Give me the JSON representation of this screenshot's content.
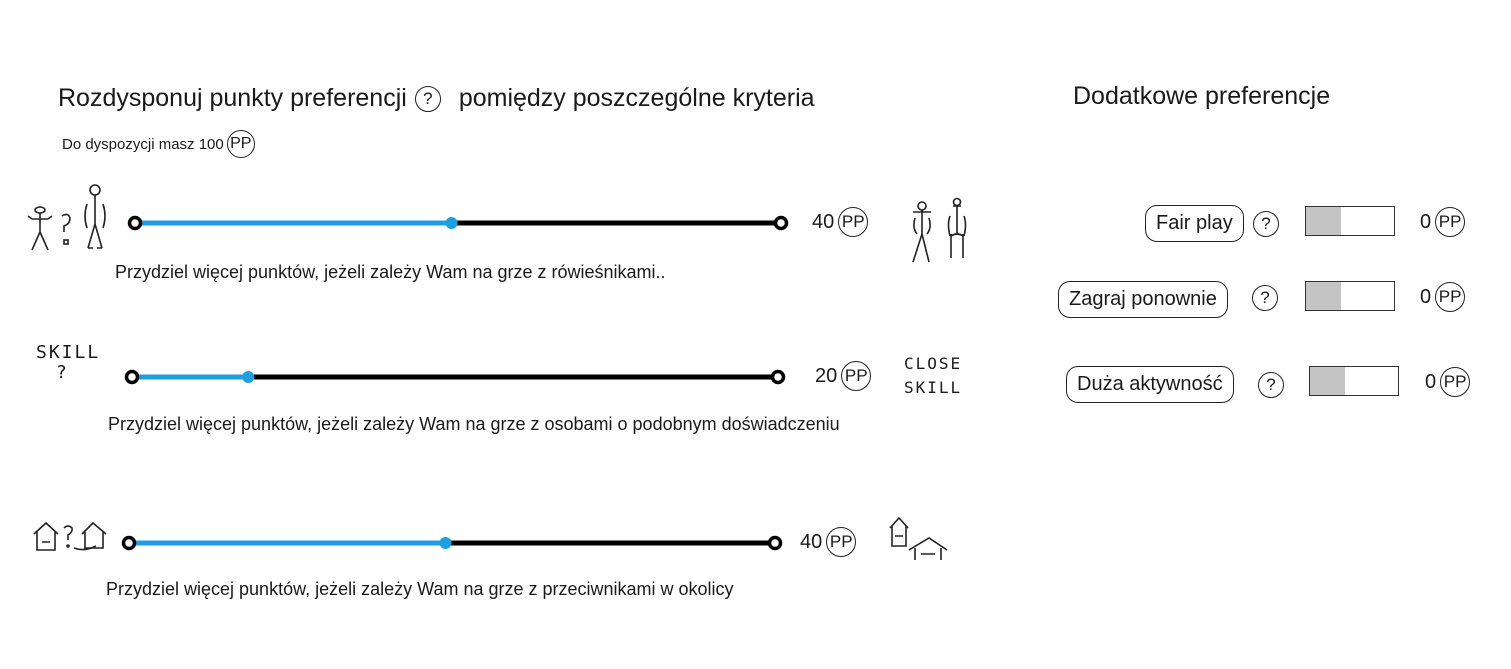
{
  "header": {
    "title_part1": "Rozdysponuj punkty preferencji",
    "title_help": "?",
    "title_part2": "pomiędzy poszczególne kryteria",
    "budget_text": "Do dyspozycji masz 100",
    "budget_unit": "PP"
  },
  "criteria": [
    {
      "value": "40",
      "unit": "PP",
      "fraction": 0.49,
      "description": "Przydziel więcej punktów, jeżeli zależy Wam na grze z rówieśnikami..",
      "left_icon": "stick-figures-question-icon",
      "right_icon": "stick-figures-peers-icon"
    },
    {
      "value": "20",
      "unit": "PP",
      "fraction": 0.18,
      "description": "Przydziel więcej punktów, jeżeli zależy Wam na grze z osobami o podobnym doświadczeniu",
      "left_icon": "skill-question-icon",
      "left_text": "SKILL",
      "left_q": "?",
      "right_icon": "close-skill-icon",
      "right_text1": "CLOSE",
      "right_text2": "SKILL"
    },
    {
      "value": "40",
      "unit": "PP",
      "fraction": 0.49,
      "description": "Przydziel więcej punktów, jeżeli zależy Wam na grze z przeciwnikami w okolicy",
      "left_icon": "houses-question-icon",
      "right_icon": "houses-near-icon"
    }
  ],
  "extra": {
    "title": "Dodatkowe preferencje",
    "items": [
      {
        "label": "Fair play",
        "help": "?",
        "value": "0",
        "unit": "PP",
        "fraction": 0.4
      },
      {
        "label": "Zagraj ponownie",
        "help": "?",
        "value": "0",
        "unit": "PP",
        "fraction": 0.4
      },
      {
        "label": "Duża aktywność",
        "help": "?",
        "value": "0",
        "unit": "PP",
        "fraction": 0.4
      }
    ]
  },
  "colors": {
    "slider_filled": "#1ea0e0",
    "slider_track": "#000000",
    "toggle_fill": "#c4c4c4"
  }
}
